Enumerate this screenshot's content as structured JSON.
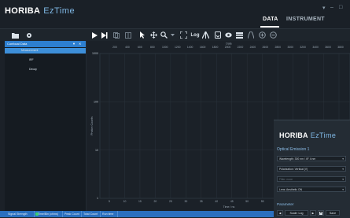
{
  "app": {
    "brand_horiba": "HORIBA",
    "brand_ez": "EzTime"
  },
  "top_tabs": [
    {
      "label": "DATA",
      "active": true
    },
    {
      "label": "INSTRUMENT",
      "active": false
    }
  ],
  "window_controls": [
    "▾",
    "–",
    "□"
  ],
  "toolbar": {
    "icons": [
      "folder-open-icon",
      "settings-icon",
      "play-icon",
      "run-step-icon",
      "copy-icon",
      "grid-icon",
      "pointer-icon",
      "move-icon",
      "zoom-icon",
      "zoom-menu-icon",
      "fit-icon",
      "log-icon",
      "peak-icon",
      "export-icon",
      "view-icon",
      "table-icon",
      "fit-curve-icon",
      "zoom-in-icon",
      "zoom-out-icon"
    ],
    "log_label": "Log"
  },
  "left_panel": {
    "title": "Confocal Data",
    "items": [
      {
        "label": "Measurement",
        "selected": true
      },
      {
        "label": "IRF",
        "selected": false
      },
      {
        "label": "Decay",
        "selected": false
      }
    ]
  },
  "plot": {
    "top_axis_label": "Data",
    "top_ticks": [
      "200",
      "400",
      "600",
      "800",
      "1000",
      "1200",
      "1400",
      "1600",
      "1800",
      "2000",
      "2200",
      "2400",
      "2600",
      "2800",
      "3000",
      "3200",
      "3400",
      "3600",
      "3800"
    ],
    "bottom_ticks": [
      "5",
      "10",
      "15",
      "20",
      "25",
      "30",
      "35",
      "40",
      "45",
      "50",
      "55",
      "60",
      "65",
      "70",
      "75",
      "80"
    ],
    "y_ticks": [
      "1000",
      "100",
      "10",
      "1"
    ],
    "ylabel": "Photon Counts",
    "xlabel": "Time / ns"
  },
  "status_bar": [
    "Signal Strength",
    "Time/Bin (ch/ns)",
    "Peak Count",
    "Total Count",
    "Run time"
  ],
  "right_panel": {
    "brand_horiba": "HORIBA",
    "brand_ez": "EzTime",
    "section": "Optical Emission 1",
    "fields": [
      {
        "label": "Wavelength: 300 nm / 4F 4 nm",
        "dim": false
      },
      {
        "label": "Polarization: Vertical (V)",
        "dim": false
      },
      {
        "label": "Filter: none",
        "dim": true
      },
      {
        "label": "Lens: Aesthetic ON",
        "dim": false
      }
    ],
    "param_title": "Parameter",
    "controls": {
      "prev": "◀",
      "value": "Scale: Log",
      "next": "▶",
      "save": "Save"
    }
  },
  "colors": {
    "background": "#1b2128",
    "accent": "#2d7fd0",
    "statusbar": "#2a6fbf",
    "grid": "#2a333c",
    "led": "#3bd16f"
  }
}
